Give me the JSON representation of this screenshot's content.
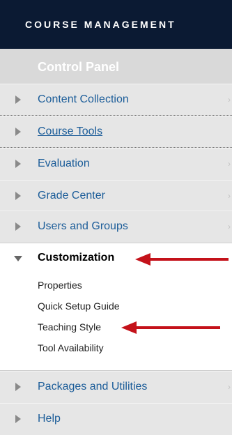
{
  "header": {
    "title": "COURSE MANAGEMENT"
  },
  "control_panel": {
    "title": "Control Panel"
  },
  "menu": [
    {
      "label": "Content Collection",
      "chevron": "›"
    },
    {
      "label": "Course Tools"
    },
    {
      "label": "Evaluation",
      "chevron": "›"
    },
    {
      "label": "Grade Center",
      "chevron": "›"
    },
    {
      "label": "Users and Groups",
      "chevron": "›"
    }
  ],
  "expanded": {
    "title": "Customization",
    "items": [
      "Properties",
      "Quick Setup Guide",
      "Teaching Style",
      "Tool Availability"
    ]
  },
  "menu_after": [
    {
      "label": "Packages and Utilities",
      "chevron": "›"
    },
    {
      "label": "Help"
    }
  ],
  "colors": {
    "header_bg": "#0b1a33",
    "link": "#1c5d99",
    "arrow": "#c4121a"
  }
}
